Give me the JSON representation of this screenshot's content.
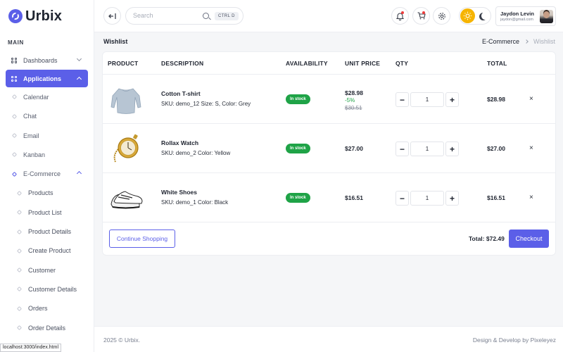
{
  "app": {
    "name": "Urbix"
  },
  "sidebar": {
    "section_title": "MAIN",
    "items": [
      {
        "label": "Dashboards"
      },
      {
        "label": "Applications"
      },
      {
        "label": "Calendar"
      },
      {
        "label": "Chat"
      },
      {
        "label": "Email"
      },
      {
        "label": "Kanban"
      },
      {
        "label": "E-Commerce"
      },
      {
        "label": "Products"
      },
      {
        "label": "Product List"
      },
      {
        "label": "Product Details"
      },
      {
        "label": "Create Product"
      },
      {
        "label": "Customer"
      },
      {
        "label": "Customer Details"
      },
      {
        "label": "Orders"
      },
      {
        "label": "Order Details"
      }
    ]
  },
  "header": {
    "search_placeholder": "Search",
    "search_shortcut": "CTRL D",
    "user_name": "Jaydon Levin",
    "user_email": "jaydon@gmail.com"
  },
  "page": {
    "title": "Wishlist",
    "breadcrumb": [
      "E-Commerce",
      "Wishlist"
    ]
  },
  "table": {
    "columns": [
      "PRODUCT",
      "DESCRIPTION",
      "AVAILABILITY",
      "UNIT PRICE",
      "QTY",
      "TOTAL"
    ],
    "rows": [
      {
        "name": "Cotton T-shirt",
        "desc": "SKU: demo_12 Size: S, Color: Grey",
        "availability": "In stock",
        "price": "$28.98",
        "discount": "-5%",
        "old_price": "$30.51",
        "qty": "1",
        "total": "$28.98",
        "remove": "×"
      },
      {
        "name": "Rollax Watch",
        "desc": "SKU: demo_2 Color: Yellow",
        "availability": "In stock",
        "price": "$27.00",
        "qty": "1",
        "total": "$27.00",
        "remove": "×"
      },
      {
        "name": "White Shoes",
        "desc": "SKU: demo_1 Color: Black",
        "availability": "In stock",
        "price": "$16.51",
        "qty": "1",
        "total": "$16.51",
        "remove": "×"
      }
    ]
  },
  "summary": {
    "continue_label": "Continue Shopping",
    "total_label": "Total: $72.49",
    "checkout_label": "Checkout"
  },
  "footer": {
    "copyright": "2025 © Urbix.",
    "credits": "Design & Develop by Pixeleyez"
  },
  "status_bar": {
    "url": "localhost:3000/index.html"
  },
  "colors": {
    "accent": "#5b5fe8",
    "success": "#1fa347",
    "warning": "#f6b400"
  }
}
